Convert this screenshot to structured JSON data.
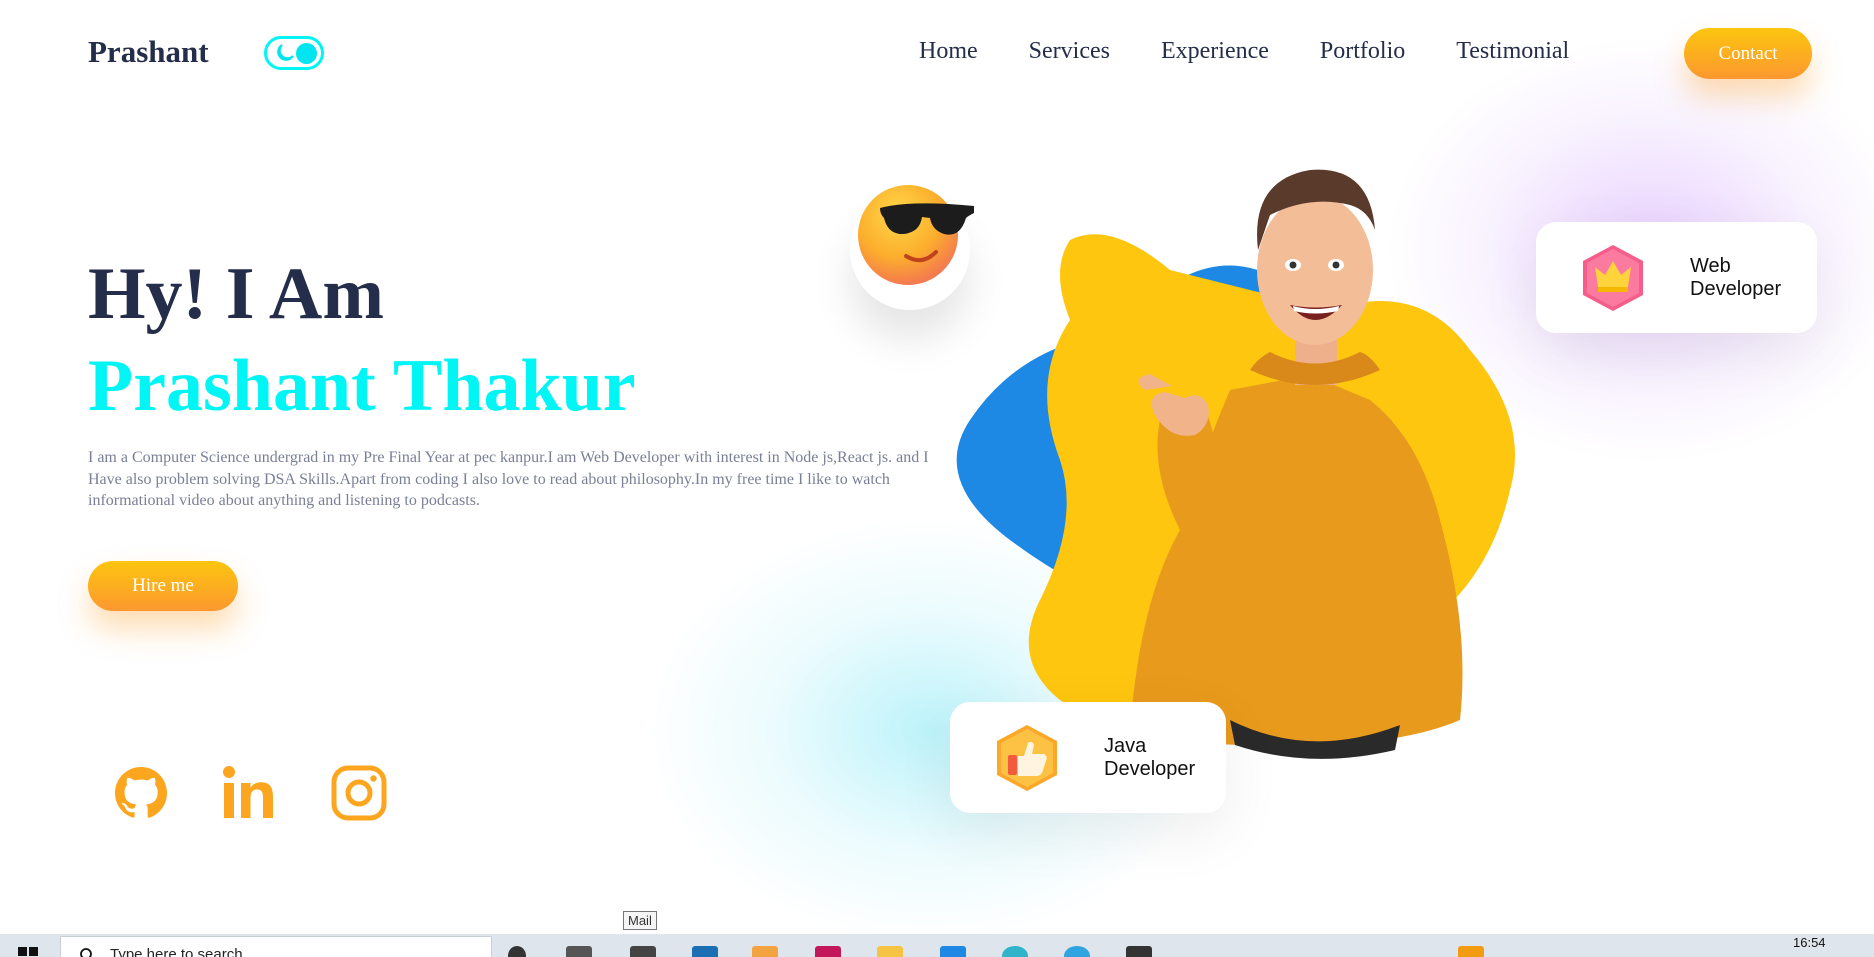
{
  "navbar": {
    "logo": "Prashant",
    "links": [
      "Home",
      "Services",
      "Experience",
      "Portfolio",
      "Testimonial"
    ],
    "contact_label": "Contact"
  },
  "hero": {
    "greeting": "Hy! I Am",
    "name": "Prashant Thakur",
    "description": "I am a Computer Science undergrad in my Pre Final Year at pec kanpur.I am Web Developer with interest in Node js,React js. and I Have also problem solving DSA Skills.Apart from coding I also love to read about philosophy.In my free time I like to watch informational video about anything and listening to podcasts.",
    "hire_label": "Hire me"
  },
  "social": [
    "github-icon",
    "linkedin-icon",
    "instagram-icon"
  ],
  "cards": {
    "web": "Web\nDeveloper",
    "java": "Java\nDeveloper"
  },
  "taskbar": {
    "search_placeholder": "Type here to search",
    "tooltip": "Mail",
    "time": "16:54"
  },
  "colors": {
    "accent_cyan": "#00f5f5",
    "orange": "#fca61f",
    "yellow": "#fdc50f",
    "blue": "#1e88e5",
    "text": "#242d49"
  }
}
